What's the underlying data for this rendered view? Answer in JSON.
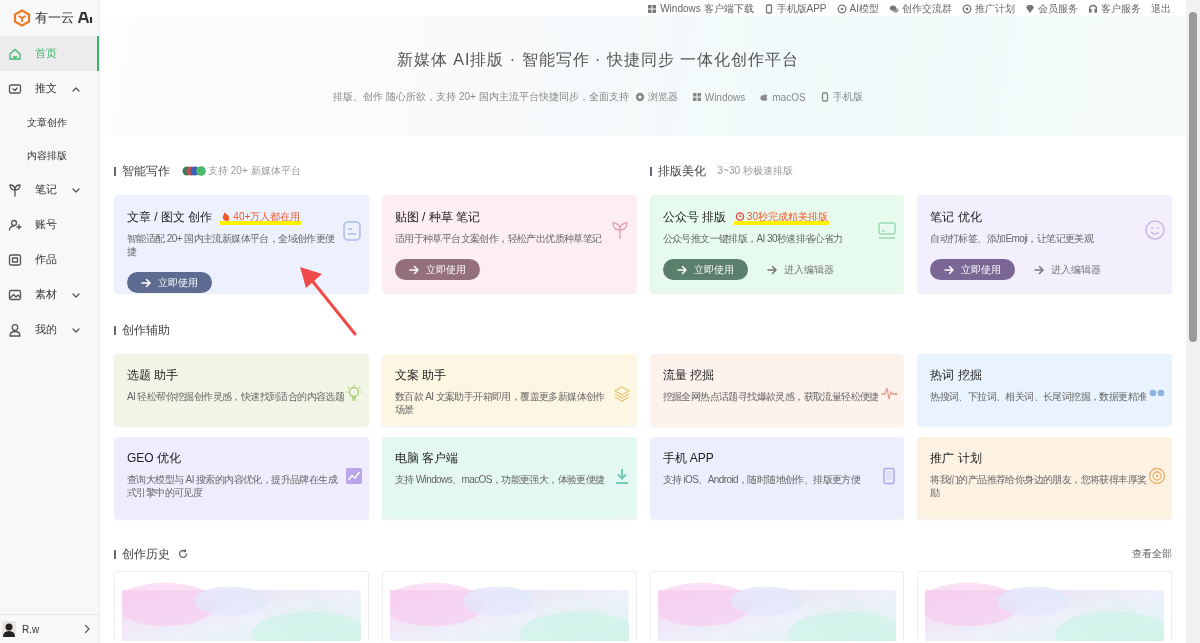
{
  "sidebar": {
    "logo": "有一云",
    "items": [
      {
        "label": "首页",
        "selected": true
      },
      {
        "label": "推文",
        "selected": false,
        "expanded": true,
        "children": [
          {
            "label": "文章创作",
            "selected": false
          },
          {
            "label": "内容排版",
            "selected": false
          }
        ]
      },
      {
        "label": "笔记",
        "selected": false,
        "expanded": false
      },
      {
        "label": "账号",
        "selected": false
      },
      {
        "label": "作品",
        "selected": false
      },
      {
        "label": "素材",
        "selected": false,
        "expanded": false
      },
      {
        "label": "我的",
        "selected": false,
        "expanded": false
      }
    ],
    "user": {
      "name": "R.w"
    }
  },
  "top_links": [
    "Windows 客户端下载",
    "手机版APP",
    "AI模型",
    "创作交流群",
    "推广计划",
    "会员服务",
    "客户服务",
    "退出"
  ],
  "hero": {
    "title": "新媒体 AI排版 · 智能写作 · 快捷同步 一体化创作平台",
    "subtitle": "排版、创作 随心所欲，支持 20+ 国内主流平台快捷同步，全面支持",
    "platforms": [
      "浏览器",
      "Windows",
      "macOS",
      "手机版"
    ]
  },
  "main_sections": [
    {
      "title": "智能写作",
      "note": "支持 20+ 新媒体平台"
    },
    {
      "title": "排版美化",
      "note": "3~30 秒极速排版"
    }
  ],
  "main_cards": [
    {
      "title": "文章 / 图文 创作",
      "badge": {
        "text": "40+万人都在用",
        "kind": "fire"
      },
      "desc": "智能适配 20+ 国内主流新媒体平台，全域创作更便捷",
      "color": "#ecf1fd",
      "button": {
        "label": "立即使用",
        "color": "#5e6b91"
      }
    },
    {
      "title": "贴图 / 种草 笔记",
      "desc": "适用于种草平台文案创作，轻松产出优质种草笔记",
      "color": "#fdeef2",
      "button": {
        "label": "立即使用",
        "color": "#93707c"
      }
    },
    {
      "title": "公众号 排版",
      "badge": {
        "text": "30秒完成精美排版",
        "kind": "clock"
      },
      "desc": "公众号推文一键排版，AI 30秒速排省心省力",
      "color": "#e6fbee",
      "button": {
        "label": "立即使用",
        "color": "#5a7f6a"
      },
      "link": "进入编辑器"
    },
    {
      "title": "笔记 优化",
      "desc": "自动打标签、添加Emoji，让笔记更美观",
      "color": "#f3effd",
      "button": {
        "label": "立即使用",
        "color": "#7a6795"
      },
      "link": "进入编辑器"
    }
  ],
  "assist": {
    "title": "创作辅助",
    "cards": [
      {
        "title": "选题 助手",
        "desc": "AI 轻松帮你挖掘创作灵感，快速找到适合的内容选题",
        "color": "#f0f5e6"
      },
      {
        "title": "文案 助手",
        "desc": "数百款 AI 文案助手开箱即用，覆盖更多新媒体创作场景",
        "color": "#fdf6e2"
      },
      {
        "title": "流量 挖掘",
        "desc": "挖掘全网热点话题寻找爆款灵感，获取流量轻松便捷",
        "color": "#fdf3ec"
      },
      {
        "title": "热词 挖掘",
        "desc": "热搜词、下拉词、相关词、长尾词挖掘，数据更精准",
        "color": "#e8f3fd"
      },
      {
        "title": "GEO 优化",
        "desc": "查询大模型与 AI 搜索的内容优化，提升品牌在生成式引擎中的可见度",
        "color": "#f1ecfd"
      },
      {
        "title": "电脑 客户端",
        "desc": "支持 Windows、macOS，功能更强大，体验更便捷",
        "color": "#e4f8f3"
      },
      {
        "title": "手机 APP",
        "desc": "支持 iOS、Android，随时随地创作、排版更方便",
        "color": "#eceefd"
      },
      {
        "title": "推广 计划",
        "desc": "将我们的产品推荐给你身边的朋友，您将获得丰厚奖励",
        "color": "#fdf1e2"
      }
    ]
  },
  "history": {
    "title": "创作历史",
    "view_all": "查看全部"
  },
  "annotations": [
    {
      "kind": "arrow"
    }
  ]
}
